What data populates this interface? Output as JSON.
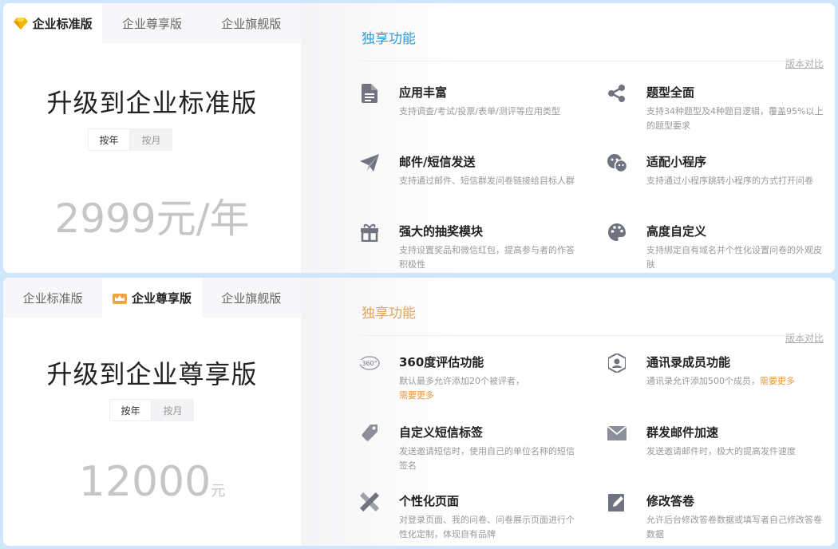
{
  "colors": {
    "standard_accent": "#2f9be0",
    "premium_accent": "#e2a45a",
    "more_link": "#e29a45",
    "icon_gray": "#6f7480"
  },
  "standard": {
    "tabs": [
      "企业标准版",
      "企业尊享版",
      "企业旗舰版"
    ],
    "active_tab": 0,
    "compare_link": "版本对比",
    "title": "升级到企业标准版",
    "period": [
      "按年",
      "按月"
    ],
    "price": "2999元/年",
    "section_title": "独享功能",
    "features": [
      {
        "icon": "document-icon",
        "title": "应用丰富",
        "desc": "支持调查/考试/投票/表单/测评等应用类型"
      },
      {
        "icon": "share-icon",
        "title": "题型全面",
        "desc": "支持34种题型及4种题目逻辑，覆盖95%以上的题型要求"
      },
      {
        "icon": "paper-plane-icon",
        "title": "邮件/短信发送",
        "desc": "支持通过邮件、短信群发问卷链接给目标人群"
      },
      {
        "icon": "mini-program-icon",
        "title": "适配小程序",
        "desc": "支持通过小程序跳转小程序的方式打开问卷"
      },
      {
        "icon": "gift-icon",
        "title": "强大的抽奖模块",
        "desc": "支持设置奖品和微信红包，提高参与者的作答积极性"
      },
      {
        "icon": "palette-icon",
        "title": "高度自定义",
        "desc": "支持绑定自有域名并个性化设置问卷的外观皮肤"
      }
    ]
  },
  "premium": {
    "tabs": [
      "企业标准版",
      "企业尊享版",
      "企业旗舰版"
    ],
    "active_tab": 1,
    "compare_link": "版本对比",
    "title": "升级到企业尊享版",
    "period": [
      "按年",
      "按月"
    ],
    "price_amount": "12000",
    "price_unit": "元",
    "section_title": "独享功能",
    "features": [
      {
        "icon": "360-icon",
        "title": "360度评估功能",
        "desc": "默认最多允许添加20个被评者，",
        "more": "需要更多"
      },
      {
        "icon": "contact-icon",
        "title": "通讯录成员功能",
        "desc": "通讯录允许添加500个成员，",
        "more": "需要更多"
      },
      {
        "icon": "tag-icon",
        "title": "自定义短信标签",
        "desc": "发送邀请短信时，使用自己的单位名称的短信签名"
      },
      {
        "icon": "envelope-icon",
        "title": "群发邮件加速",
        "desc": "发送邀请邮件时，极大的提高发件速度"
      },
      {
        "icon": "pen-ruler-icon",
        "title": "个性化页面",
        "desc": "对登录页面、我的问卷、问卷展示页面进行个性化定制，体现自有品牌"
      },
      {
        "icon": "edit-icon",
        "title": "修改答卷",
        "desc": "允许后台修改答卷数据或填写者自己修改答卷数据"
      }
    ]
  }
}
